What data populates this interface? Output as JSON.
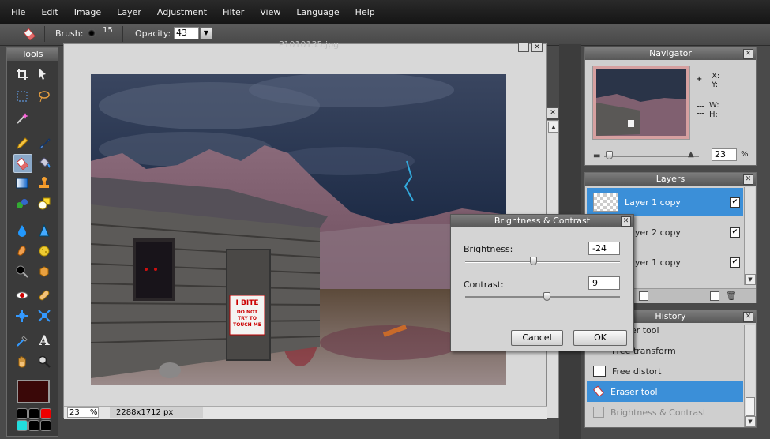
{
  "menu": [
    "File",
    "Edit",
    "Image",
    "Layer",
    "Adjustment",
    "Filter",
    "View",
    "Language",
    "Help"
  ],
  "options": {
    "brush_label": "Brush:",
    "brush_size": "15",
    "opacity_label": "Opacity:",
    "opacity_value": "43"
  },
  "tools": {
    "title": "Tools"
  },
  "document": {
    "title": "P1010135.jpg",
    "zoom": "23",
    "zoom_unit": "%",
    "dimensions": "2288x1712 px",
    "sign_line1": "I BITE",
    "sign_line2": "DO NOT",
    "sign_line3": "TRY TO",
    "sign_line4": "TOUCH ME"
  },
  "navigator": {
    "title": "Navigator",
    "x_label": "X:",
    "y_label": "Y:",
    "w_label": "W:",
    "h_label": "H:",
    "zoom": "23",
    "zoom_unit": "%"
  },
  "layers": {
    "title": "Layers",
    "items": [
      {
        "name": "Layer 1 copy",
        "selected": true
      },
      {
        "name": "Layer 2 copy",
        "selected": false
      },
      {
        "name": "Layer 1 copy",
        "selected": false
      }
    ]
  },
  "history": {
    "title": "History",
    "items": [
      {
        "label": "Eraser tool"
      },
      {
        "label": "Free transform"
      },
      {
        "label": "Free distort"
      },
      {
        "label": "Eraser tool",
        "selected": true
      },
      {
        "label": "Brightness & Contrast",
        "dim": true
      }
    ]
  },
  "dialog": {
    "title": "Brightness & Contrast",
    "brightness_label": "Brightness:",
    "brightness_value": "-24",
    "contrast_label": "Contrast:",
    "contrast_value": "9",
    "cancel": "Cancel",
    "ok": "OK",
    "brightness_level": 0.44,
    "contrast_level": 0.53
  },
  "colors": {
    "accent": "#3b8fd8",
    "primary_color": "#3a0808"
  }
}
